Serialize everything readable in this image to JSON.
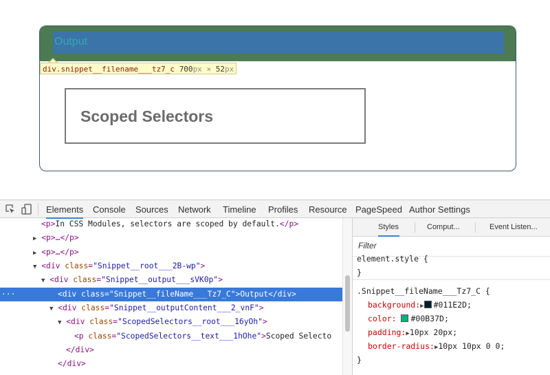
{
  "preview": {
    "filename": "Output",
    "scoped_text": "Scoped Selectors",
    "tooltip": {
      "selector": "div.snippet__filename___tz7_c",
      "width": "700",
      "unit1": "px",
      "times": "×",
      "height": "52",
      "unit2": "px"
    }
  },
  "devtools": {
    "tabs": [
      "Elements",
      "Console",
      "Sources",
      "Network",
      "Timeline",
      "Profiles",
      "Resource",
      "PageSpeed",
      "Author Settings"
    ],
    "active_tab": "Elements",
    "dom": {
      "r1_open": "<p>",
      "r1_text": "In CSS Modules, selectors are scoped by default.",
      "r1_close": "</p>",
      "r2": "<p>…</p>",
      "r3": "<p>…</p>",
      "r4_tag": "<div",
      "r4_attr": "class",
      "r4_val": "\"Snippet__root___2B-wp\"",
      "r4_end": ">",
      "r5_tag": "<div",
      "r5_attr": "class",
      "r5_val": "\"Snippet__output___sVK0p\"",
      "r5_end": ">",
      "r6_dots": "···",
      "r6_tag": "<div",
      "r6_attr": "class",
      "r6_val": "\"Snippet__fileName___Tz7_C\"",
      "r6_mid": ">",
      "r6_text": "Output",
      "r6_end": "</div>",
      "r7_tag": "<div",
      "r7_attr": "class",
      "r7_val": "\"Snippet__outputContent___2_vnF\"",
      "r7_end": ">",
      "r8_tag": "<div",
      "r8_attr": "class",
      "r8_val": "\"ScopedSelectors__root___16yOh\"",
      "r8_end": ">",
      "r9_tag": "<p",
      "r9_attr": "class",
      "r9_val": "\"ScopedSelectors__text___1hOhe\"",
      "r9_end": ">",
      "r9_text": "Scoped Selecto",
      "r10": "</div>",
      "r11": "</div>"
    },
    "styles": {
      "subtabs": [
        "Styles",
        "Comput...",
        "Event Listen..."
      ],
      "filter_label": "Filter",
      "element_style": "element.style {",
      "close_brace": "}",
      "rule_selector": ".Snippet__fileName___Tz7_C {",
      "background_prop": "background:",
      "background_val": "#011E2D;",
      "background_color": "#011E2D",
      "color_prop": "color:",
      "color_val": "#00B37D;",
      "color_color": "#00B37D",
      "padding_prop": "padding:",
      "padding_val": "10px 20px;",
      "radius_prop": "border-radius:",
      "radius_val": "10px 10px 0 0;"
    }
  }
}
